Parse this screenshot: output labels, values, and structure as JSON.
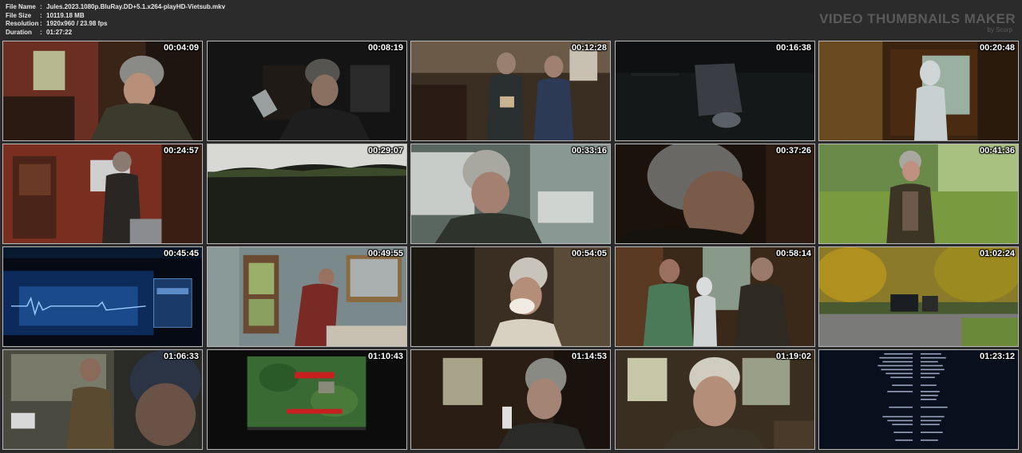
{
  "file_info": [
    {
      "label": "File Name",
      "value": "Jules.2023.1080p.BluRay.DD+5.1.x264-playHD-Vietsub.mkv"
    },
    {
      "label": "File Size",
      "value": "10119.18 MB"
    },
    {
      "label": "Resolution",
      "value": "1920x960 / 23.98 fps"
    },
    {
      "label": "Duration",
      "value": "01:27:22"
    }
  ],
  "separator": ":",
  "brand": {
    "title": "VIDEO THUMBNAILS MAKER",
    "subtitle": "by Scorp"
  },
  "thumbnails": [
    {
      "time": "00:04:09"
    },
    {
      "time": "00:08:19"
    },
    {
      "time": "00:12:28"
    },
    {
      "time": "00:16:38"
    },
    {
      "time": "00:20:48"
    },
    {
      "time": "00:24:57"
    },
    {
      "time": "00:29:07"
    },
    {
      "time": "00:33:16"
    },
    {
      "time": "00:37:26"
    },
    {
      "time": "00:41:36"
    },
    {
      "time": "00:45:45"
    },
    {
      "time": "00:49:55"
    },
    {
      "time": "00:54:05"
    },
    {
      "time": "00:58:14"
    },
    {
      "time": "01:02:24"
    },
    {
      "time": "01:06:33"
    },
    {
      "time": "01:10:43"
    },
    {
      "time": "01:14:53"
    },
    {
      "time": "01:19:02"
    },
    {
      "time": "01:23:12"
    }
  ]
}
